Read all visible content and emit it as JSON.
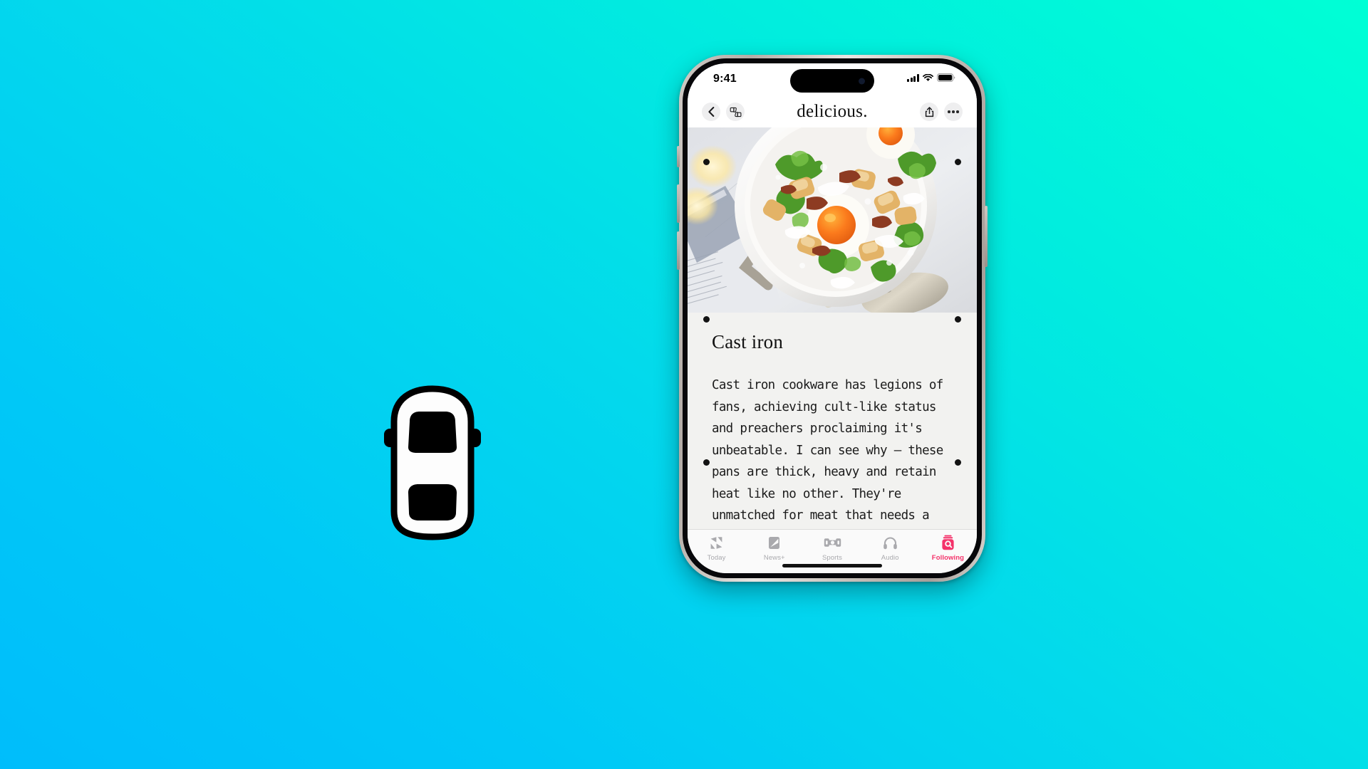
{
  "background": {
    "gradient_from": "#00bdfb",
    "gradient_to": "#00ffd5",
    "description": "cyan to spring-green diagonal gradient"
  },
  "car_icon": {
    "name": "car-top-view-icon",
    "body_color": "#ffffff",
    "outline_color": "#000000",
    "window_color": "#000000"
  },
  "phone": {
    "frame_color": "#c9c3bd",
    "bezel_color": "#07070a",
    "status_bar": {
      "time": "9:41",
      "cellular_icon": "cellular-bars-icon",
      "wifi_icon": "wifi-icon",
      "battery_icon": "battery-icon"
    },
    "nav_header": {
      "back_icon": "chevron-left-icon",
      "reaction_icon": "thumbs-up-down-icon",
      "title": "delicious.",
      "share_icon": "share-icon",
      "more_icon": "ellipsis-icon"
    },
    "article": {
      "hero_alt": "Skillet of fried potatoes, kale, bacon and eggs with creamy dressing",
      "heading": "Cast iron",
      "body": "Cast iron cookware has legions of fans, achieving cult-like status and preachers proclaiming it's unbeatable. I can see why – these pans are thick, heavy and retain heat like no other. They're unmatched for meat that needs a strong sear: hav-"
    },
    "tab_bar": {
      "active_color": "#f4326a",
      "inactive_color": "#a9a9ad",
      "tabs": [
        {
          "label": "Today",
          "icon": "apple-news-icon",
          "active": false
        },
        {
          "label": "News+",
          "icon": "news-plus-icon",
          "active": false
        },
        {
          "label": "Sports",
          "icon": "sports-icon",
          "active": false
        },
        {
          "label": "Audio",
          "icon": "headphones-icon",
          "active": false
        },
        {
          "label": "Following",
          "icon": "following-search-icon",
          "active": true
        }
      ]
    }
  }
}
